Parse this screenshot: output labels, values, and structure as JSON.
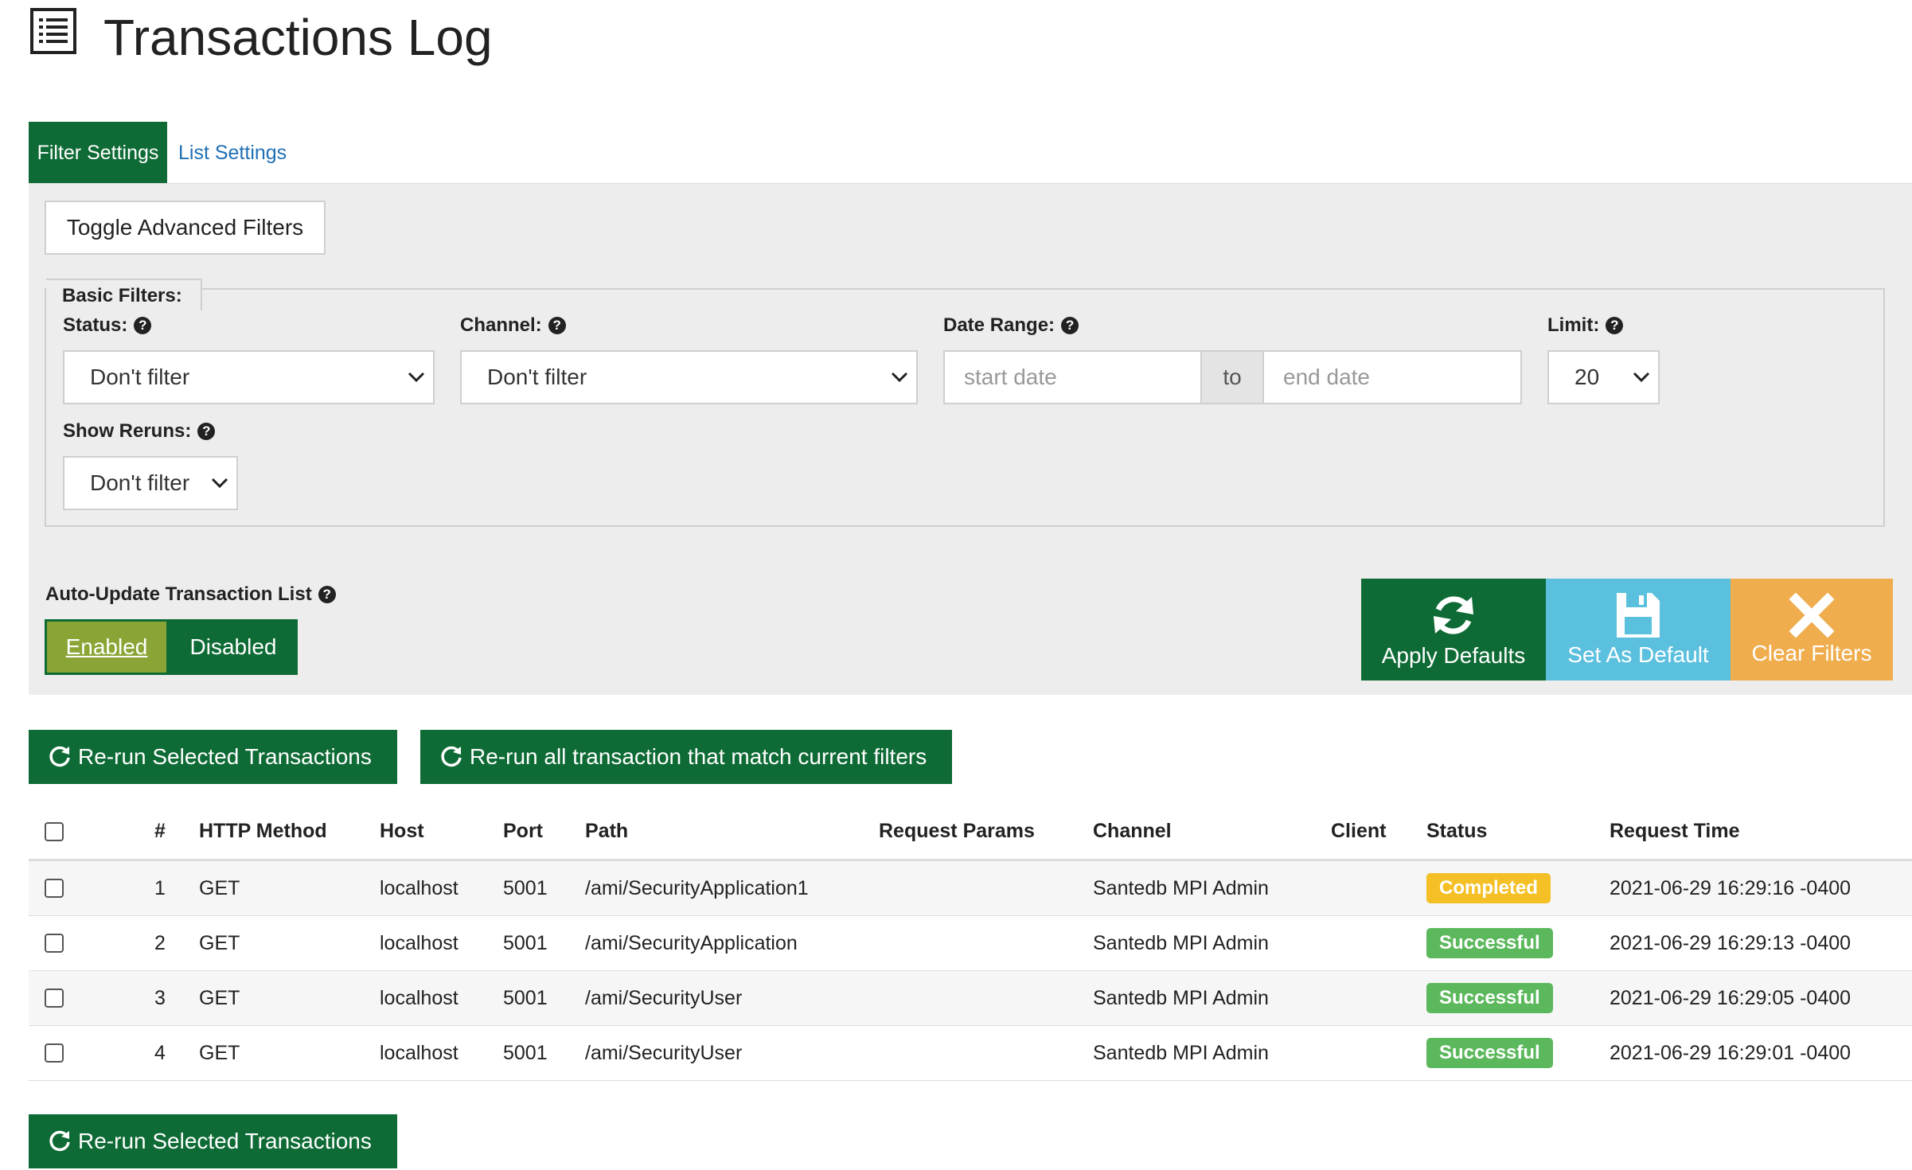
{
  "page": {
    "title": "Transactions Log"
  },
  "tabs": [
    {
      "label": "Filter Settings",
      "active": true
    },
    {
      "label": "List Settings",
      "active": false
    }
  ],
  "filters": {
    "toggle_advanced_label": "Toggle Advanced Filters",
    "basic_legend": "Basic Filters:",
    "status": {
      "label": "Status:",
      "value": "Don't filter"
    },
    "channel": {
      "label": "Channel:",
      "value": "Don't filter"
    },
    "date_range": {
      "label": "Date Range:",
      "start_placeholder": "start date",
      "separator": "to",
      "end_placeholder": "end date"
    },
    "limit": {
      "label": "Limit:",
      "value": "20"
    },
    "show_reruns": {
      "label": "Show Reruns:",
      "value": "Don't filter"
    }
  },
  "auto_update": {
    "label": "Auto-Update Transaction List",
    "enabled_label": "Enabled",
    "disabled_label": "Disabled",
    "state": "Enabled"
  },
  "actions": {
    "apply_defaults": "Apply Defaults",
    "set_as_default": "Set As Default",
    "clear_filters": "Clear Filters"
  },
  "rerun": {
    "selected": "Re-run Selected Transactions",
    "all_matching": "Re-run all transaction that match current filters"
  },
  "table": {
    "headers": {
      "num": "#",
      "method": "HTTP Method",
      "host": "Host",
      "port": "Port",
      "path": "Path",
      "params": "Request Params",
      "channel": "Channel",
      "client": "Client",
      "status": "Status",
      "time": "Request Time"
    },
    "rows": [
      {
        "num": "1",
        "method": "GET",
        "host": "localhost",
        "port": "5001",
        "path": "/ami/SecurityApplication1",
        "params": "",
        "channel": "Santedb MPI Admin",
        "client": "",
        "status": "Completed",
        "time": "2021-06-29 16:29:16 -0400"
      },
      {
        "num": "2",
        "method": "GET",
        "host": "localhost",
        "port": "5001",
        "path": "/ami/SecurityApplication",
        "params": "",
        "channel": "Santedb MPI Admin",
        "client": "",
        "status": "Successful",
        "time": "2021-06-29 16:29:13 -0400"
      },
      {
        "num": "3",
        "method": "GET",
        "host": "localhost",
        "port": "5001",
        "path": "/ami/SecurityUser",
        "params": "",
        "channel": "Santedb MPI Admin",
        "client": "",
        "status": "Successful",
        "time": "2021-06-29 16:29:05 -0400"
      },
      {
        "num": "4",
        "method": "GET",
        "host": "localhost",
        "port": "5001",
        "path": "/ami/SecurityUser",
        "params": "",
        "channel": "Santedb MPI Admin",
        "client": "",
        "status": "Successful",
        "time": "2021-06-29 16:29:01 -0400"
      }
    ]
  },
  "colors": {
    "primary": "#0e6b35",
    "info": "#5bc0de",
    "warning": "#f0ad4e",
    "completed": "#f5c026",
    "successful": "#5cb85c",
    "enabled": "#8aa535"
  },
  "icons": {
    "title": "list-icon",
    "help": "question-circle-icon",
    "apply": "refresh-icon",
    "save": "floppy-disk-icon",
    "clear": "x-icon",
    "rerun": "rotate-icon"
  }
}
